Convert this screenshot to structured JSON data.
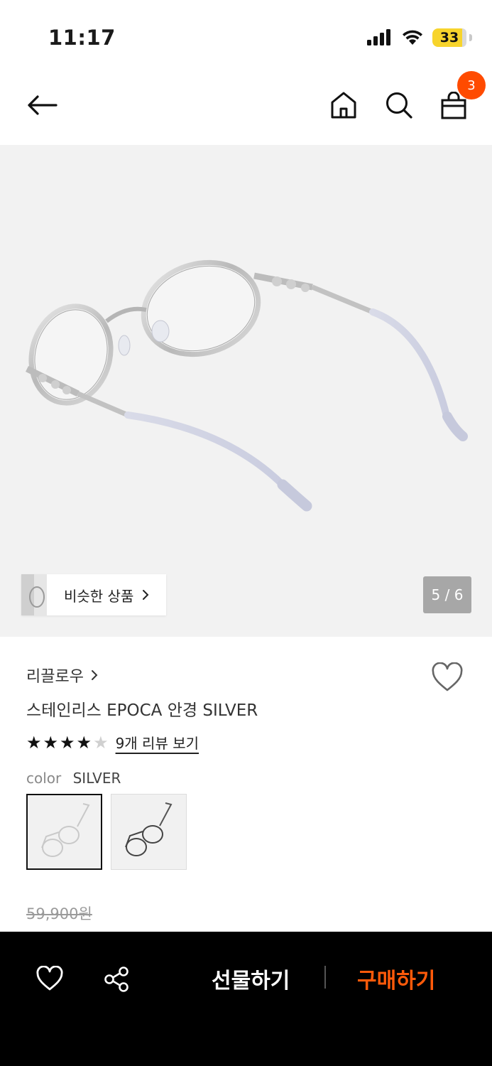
{
  "status_bar": {
    "time": "11:17",
    "battery": "33"
  },
  "nav": {
    "cart_count": "3"
  },
  "hero": {
    "similar_label": "비슷한 상품",
    "pager": "5 / 6"
  },
  "product": {
    "brand": "리끌로우",
    "title": "스테인리스 EPOCA 안경 SILVER",
    "rating": 4,
    "rating_max": 5,
    "review_link": "9개 리뷰 보기",
    "color_label": "color",
    "color_value": "SILVER",
    "original_price": "59,900원"
  },
  "bottom_bar": {
    "gift_label": "선물하기",
    "buy_label": "구매하기"
  },
  "colors": {
    "accent": "#ff4b00",
    "buy": "#ff5a0a",
    "hero_bg": "#f2f2f2"
  }
}
